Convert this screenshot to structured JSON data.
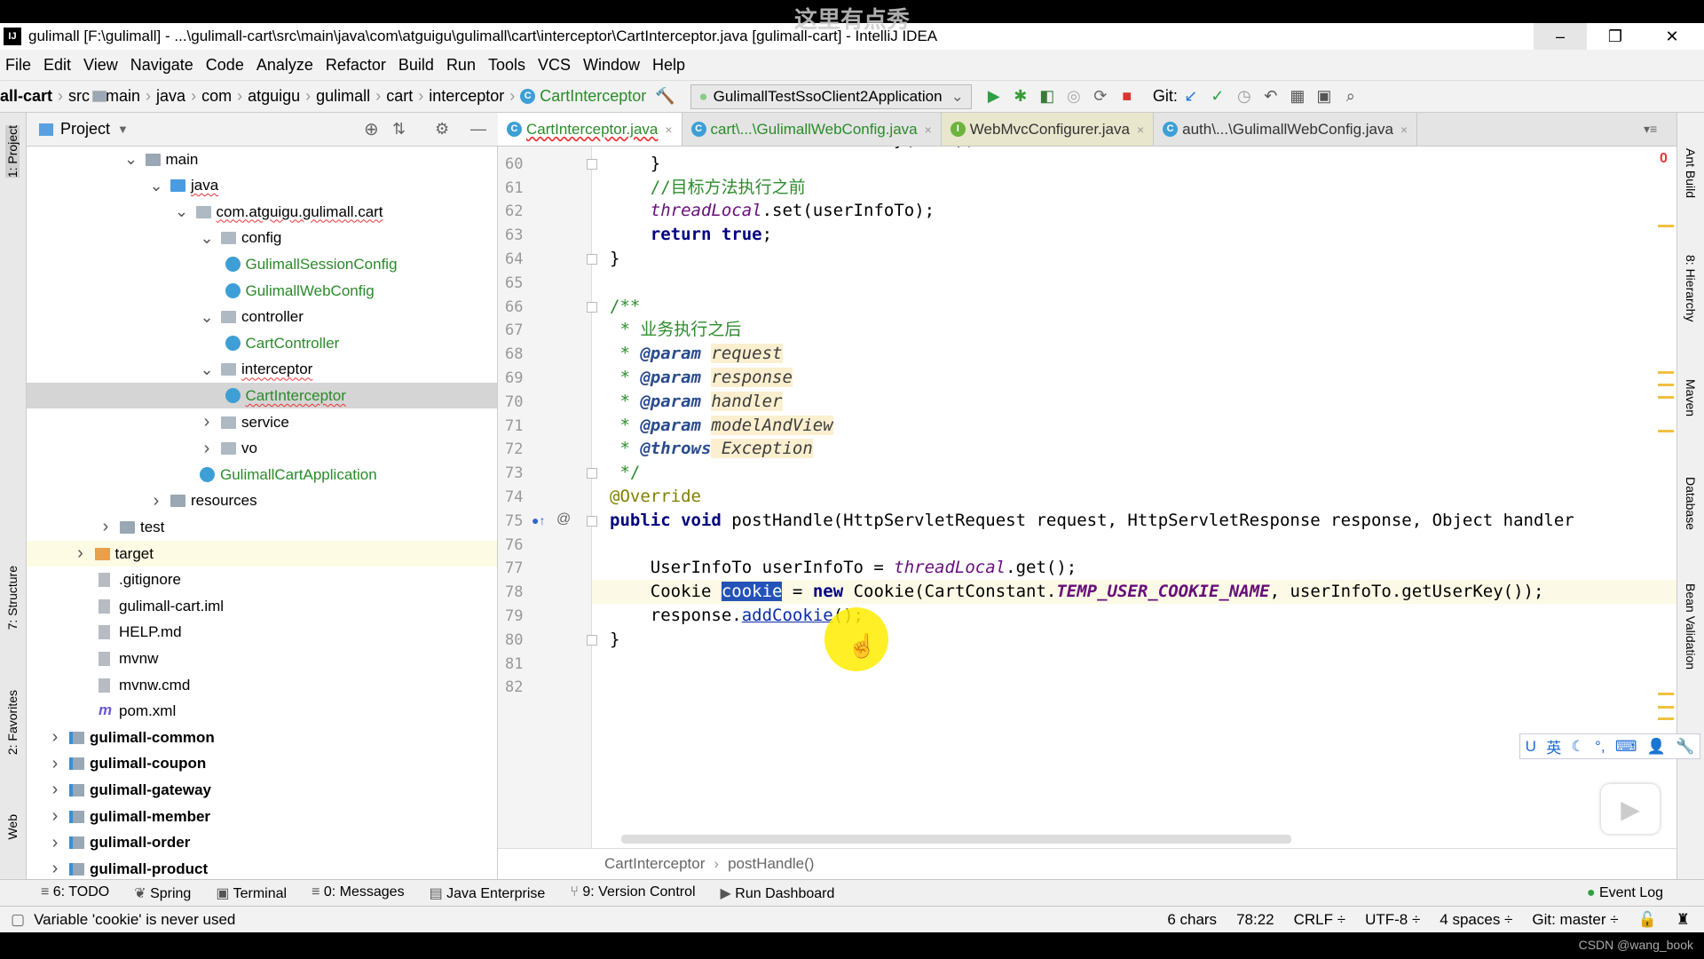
{
  "overlay_caption": "这里有点秀",
  "watermark": "CSDN @wang_book",
  "window": {
    "title": "gulimall [F:\\gulimall] - ...\\gulimall-cart\\src\\main\\java\\com\\atguigu\\gulimall\\cart\\interceptor\\CartInterceptor.java [gulimall-cart] - IntelliJ IDEA",
    "minimize": "–",
    "restore": "❐",
    "close": "✕"
  },
  "menu": [
    "File",
    "Edit",
    "View",
    "Navigate",
    "Code",
    "Analyze",
    "Refactor",
    "Build",
    "Run",
    "Tools",
    "VCS",
    "Window",
    "Help"
  ],
  "nav": {
    "crumbs": [
      "all-cart",
      "src",
      "main",
      "java",
      "com",
      "atguigu",
      "gulimall",
      "cart",
      "interceptor"
    ],
    "current": "CartInterceptor",
    "run_config": "GulimallTestSsoClient2Application",
    "git_label": "Git:"
  },
  "left_stripe": [
    "1: Project",
    "7: Structure",
    "2: Favorites",
    "Web"
  ],
  "right_stripe": [
    "Ant Build",
    "8: Hierarchy",
    "Maven",
    "Database",
    "Bean Validation"
  ],
  "project": {
    "title": "Project",
    "tree": [
      {
        "label": "main",
        "depth": 3,
        "arrow": "open",
        "icon": "folder"
      },
      {
        "label": "java",
        "depth": 4,
        "arrow": "open",
        "icon": "folder-blue",
        "wavy": true
      },
      {
        "label": "com.atguigu.gulimall.cart",
        "depth": 5,
        "arrow": "open",
        "icon": "pkg",
        "wavy": true
      },
      {
        "label": "config",
        "depth": 6,
        "arrow": "open",
        "icon": "pkg"
      },
      {
        "label": "GulimallSessionConfig",
        "depth": 7,
        "icon": "class",
        "green": true
      },
      {
        "label": "GulimallWebConfig",
        "depth": 7,
        "icon": "class",
        "green": true
      },
      {
        "label": "controller",
        "depth": 6,
        "arrow": "open",
        "icon": "pkg"
      },
      {
        "label": "CartController",
        "depth": 7,
        "icon": "class",
        "green": true
      },
      {
        "label": "interceptor",
        "depth": 6,
        "arrow": "open",
        "icon": "pkg",
        "wavy": true
      },
      {
        "label": "CartInterceptor",
        "depth": 7,
        "icon": "class",
        "green": true,
        "wavy": true,
        "selected": true
      },
      {
        "label": "service",
        "depth": 6,
        "arrow": "closed",
        "icon": "pkg"
      },
      {
        "label": "vo",
        "depth": 6,
        "arrow": "closed",
        "icon": "pkg"
      },
      {
        "label": "GulimallCartApplication",
        "depth": 6,
        "icon": "class",
        "green": true
      },
      {
        "label": "resources",
        "depth": 4,
        "arrow": "closed",
        "icon": "folder"
      },
      {
        "label": "test",
        "depth": 2,
        "arrow": "closed",
        "icon": "folder"
      },
      {
        "label": "target",
        "depth": 1,
        "arrow": "closed",
        "icon": "orange",
        "highlight": true
      },
      {
        "label": ".gitignore",
        "depth": 2,
        "icon": "file"
      },
      {
        "label": "gulimall-cart.iml",
        "depth": 2,
        "icon": "file"
      },
      {
        "label": "HELP.md",
        "depth": 2,
        "icon": "file"
      },
      {
        "label": "mvnw",
        "depth": 2,
        "icon": "file"
      },
      {
        "label": "mvnw.cmd",
        "depth": 2,
        "icon": "file"
      },
      {
        "label": "pom.xml",
        "depth": 2,
        "icon": "maven"
      },
      {
        "label": "gulimall-common",
        "depth": 0,
        "arrow": "closed",
        "icon": "mod",
        "bold": true
      },
      {
        "label": "gulimall-coupon",
        "depth": 0,
        "arrow": "closed",
        "icon": "mod",
        "bold": true
      },
      {
        "label": "gulimall-gateway",
        "depth": 0,
        "arrow": "closed",
        "icon": "mod",
        "bold": true
      },
      {
        "label": "gulimall-member",
        "depth": 0,
        "arrow": "closed",
        "icon": "mod",
        "bold": true
      },
      {
        "label": "gulimall-order",
        "depth": 0,
        "arrow": "closed",
        "icon": "mod",
        "bold": true
      },
      {
        "label": "gulimall-product",
        "depth": 0,
        "arrow": "closed",
        "icon": "mod",
        "bold": true
      }
    ]
  },
  "tabs": [
    {
      "label": "CartInterceptor.java",
      "icon": "C",
      "active": true,
      "color": "#2a8b2a",
      "bg": "#ffffff"
    },
    {
      "label": "cart\\...\\GulimallWebConfig.java",
      "icon": "C",
      "color": "#2a8b2a",
      "bg": "#e4e4e4"
    },
    {
      "label": "WebMvcConfigurer.java",
      "icon": "I",
      "color": "#333333",
      "bg": "#e8e6cc"
    },
    {
      "label": "auth\\...\\GulimallWebConfig.java",
      "icon": "C",
      "color": "#333333",
      "bg": "#e4e4e4"
    }
  ],
  "tab_close": "×",
  "editor": {
    "error_count": "0",
    "current_line": 78,
    "lines": [
      {
        "n": "59",
        "t": [
          [
            "        userInfoTo.setUserKey(uuid);",
            ""
          ]
        ]
      },
      {
        "n": "60",
        "t": [
          [
            "    }",
            ""
          ]
        ]
      },
      {
        "n": "61",
        "t": [
          [
            "    //目标方法执行之前",
            "cmg"
          ]
        ]
      },
      {
        "n": "62",
        "t": [
          [
            "    ",
            ""
          ],
          [
            "threadLocal",
            "fld"
          ],
          [
            ".set(userInfoTo);",
            ""
          ]
        ]
      },
      {
        "n": "63",
        "t": [
          [
            "    ",
            ""
          ],
          [
            "return true",
            "kw"
          ],
          [
            ";",
            ""
          ]
        ]
      },
      {
        "n": "64",
        "t": [
          [
            "}",
            ""
          ]
        ]
      },
      {
        "n": "65",
        "t": []
      },
      {
        "n": "66",
        "t": [
          [
            "/**",
            "cmg"
          ]
        ]
      },
      {
        "n": "67",
        "t": [
          [
            " * 业务执行之后",
            "cmg"
          ]
        ]
      },
      {
        "n": "68",
        "t": [
          [
            " * ",
            "cmg"
          ],
          [
            "@param",
            "tag"
          ],
          [
            " ",
            ""
          ],
          [
            "request",
            "par"
          ]
        ]
      },
      {
        "n": "69",
        "t": [
          [
            " * ",
            "cmg"
          ],
          [
            "@param",
            "tag"
          ],
          [
            " ",
            ""
          ],
          [
            "response",
            "par"
          ]
        ]
      },
      {
        "n": "70",
        "t": [
          [
            " * ",
            "cmg"
          ],
          [
            "@param",
            "tag"
          ],
          [
            " ",
            ""
          ],
          [
            "handler",
            "par"
          ]
        ]
      },
      {
        "n": "71",
        "t": [
          [
            " * ",
            "cmg"
          ],
          [
            "@param",
            "tag"
          ],
          [
            " ",
            ""
          ],
          [
            "modelAndView",
            "par"
          ]
        ]
      },
      {
        "n": "72",
        "t": [
          [
            " * ",
            "cmg"
          ],
          [
            "@throws",
            "tag"
          ],
          [
            " Exception",
            "par"
          ]
        ]
      },
      {
        "n": "73",
        "t": [
          [
            " */",
            "cmg"
          ]
        ]
      },
      {
        "n": "74",
        "t": [
          [
            "@Override",
            "ann"
          ]
        ]
      },
      {
        "n": "75",
        "t": [
          [
            "public void",
            "kw"
          ],
          [
            " postHandle(HttpServletRequest request, HttpServletResponse response, Object handler",
            ""
          ]
        ]
      },
      {
        "n": "76",
        "t": []
      },
      {
        "n": "77",
        "t": [
          [
            "    UserInfoTo userInfoTo = ",
            ""
          ],
          [
            "threadLocal",
            "fld"
          ],
          [
            ".get();",
            ""
          ]
        ]
      },
      {
        "n": "78",
        "t": [
          [
            "    Cookie ",
            ""
          ],
          [
            "cookie",
            "sel"
          ],
          [
            " = ",
            ""
          ],
          [
            "new",
            "kw"
          ],
          [
            " Cookie(CartConstant.",
            ""
          ],
          [
            "TEMP_USER_COOKIE_NAME",
            "cst"
          ],
          [
            ", userInfoTo.getUserKey());",
            ""
          ]
        ]
      },
      {
        "n": "79",
        "t": [
          [
            "    response.",
            ""
          ],
          [
            "addCookie",
            "lnk"
          ],
          [
            "();",
            ""
          ]
        ]
      },
      {
        "n": "80",
        "t": [
          [
            "}",
            ""
          ]
        ]
      },
      {
        "n": "81",
        "t": []
      },
      {
        "n": "82",
        "t": []
      }
    ]
  },
  "breadcrumb": [
    "CartInterceptor",
    "postHandle()"
  ],
  "tool_windows": [
    "6: TODO",
    "Spring",
    "Terminal",
    "0: Messages",
    "Java Enterprise",
    "9: Version Control",
    "Run Dashboard"
  ],
  "event_log": "Event Log",
  "status": {
    "message": "Variable 'cookie' is never used",
    "selection": "6 chars",
    "position": "78:22",
    "line_sep": "CRLF ÷",
    "encoding": "UTF-8 ÷",
    "indent": "4 spaces ÷",
    "git": "Git: master ÷"
  },
  "ime": [
    "U",
    "英",
    "☾",
    "°,",
    "⌨",
    "👤",
    "🔧"
  ]
}
